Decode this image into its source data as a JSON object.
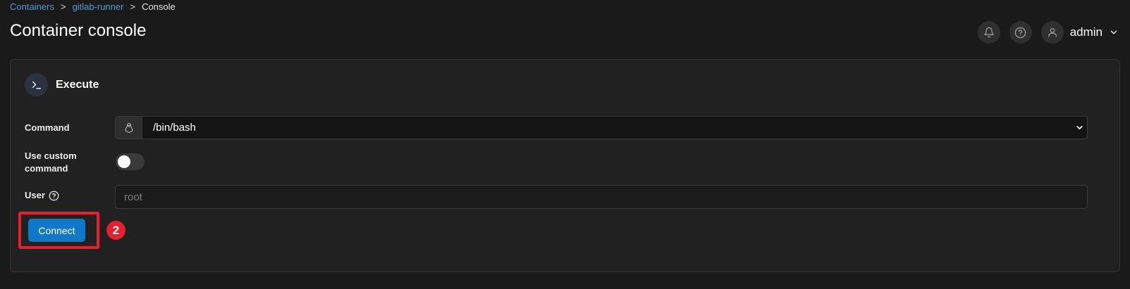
{
  "breadcrumb": {
    "items": [
      "Containers",
      "gitlab-runner"
    ],
    "separator": ">",
    "current": "Console"
  },
  "page": {
    "title": "Container console"
  },
  "header": {
    "user_name": "admin",
    "icons": [
      "bell-icon",
      "help-icon",
      "user-icon",
      "chevron-down-icon"
    ]
  },
  "panel": {
    "title": "Execute",
    "icon": "terminal-icon"
  },
  "form": {
    "command_label": "Command",
    "command_value": "/bin/bash",
    "command_addon_icon": "linux-icon",
    "custom_command_label": "Use custom command",
    "custom_command_enabled": false,
    "user_label": "User",
    "user_placeholder": "root",
    "user_value": ""
  },
  "actions": {
    "connect_label": "Connect",
    "step_number": "2"
  },
  "colors": {
    "background": "#1a1a1a",
    "panel": "#212121",
    "link": "#3ea0e6",
    "primary_button": "#0f78c8",
    "highlight": "#e8202e"
  }
}
